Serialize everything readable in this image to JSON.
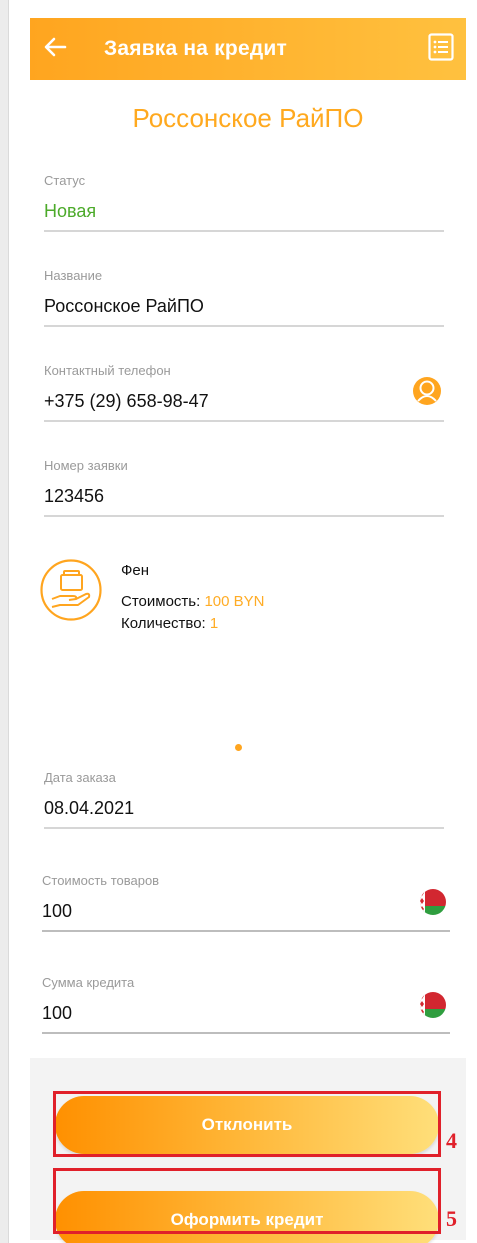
{
  "appbar": {
    "title": "Заявка на кредит"
  },
  "organization_title": "Россонское РайПО",
  "fields": {
    "status": {
      "label": "Статус",
      "value": "Новая"
    },
    "name": {
      "label": "Название",
      "value": "Россонское РайПО"
    },
    "phone": {
      "label": "Контактный телефон",
      "value": "+375 (29) 658-98-47"
    },
    "order_number": {
      "label": "Номер заявки",
      "value": "123456"
    },
    "order_date": {
      "label": "Дата заказа",
      "value": "08.04.2021"
    },
    "goods_cost": {
      "label": "Стоимость товаров",
      "value": "100"
    },
    "credit_sum": {
      "label": "Сумма кредита",
      "value": "100"
    }
  },
  "product": {
    "name": "Фен",
    "price_label": "Стоимость:",
    "price_value": "100 BYN",
    "qty_label": "Количество:",
    "qty_value": "1"
  },
  "buttons": {
    "reject": "Отклонить",
    "apply_credit": "Оформить кредит"
  },
  "annotations": {
    "reject_marker": "4",
    "apply_marker": "5"
  },
  "icons": {
    "back": "arrow-left-icon",
    "list": "list-icon",
    "contact": "person-icon",
    "product": "product-hand-icon",
    "currency": "belarus-flag-icon"
  },
  "colors": {
    "accent": "#ffa51f",
    "status_green": "#4caa2a",
    "annotation_red": "#e0202a"
  }
}
